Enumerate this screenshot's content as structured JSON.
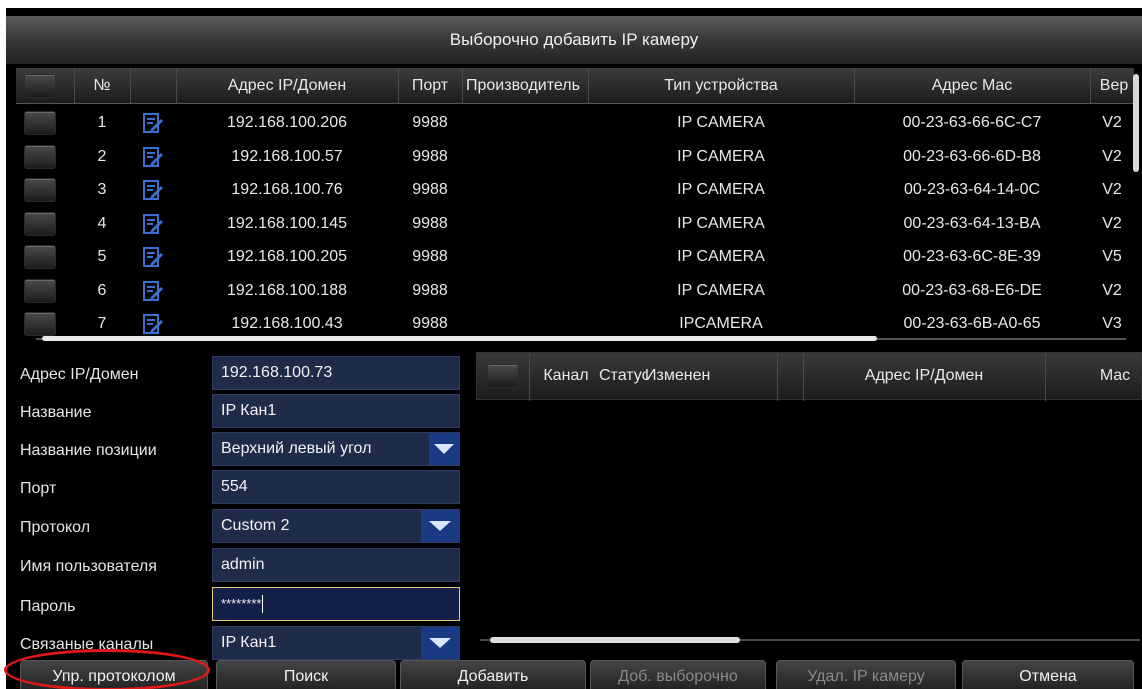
{
  "window": {
    "title": "Выборочно добавить IP камеру"
  },
  "camera_table": {
    "columns": [
      "№",
      "Адрес IP/Домен",
      "Порт",
      "Производитель",
      "Тип устройства",
      "Адрес Mac",
      "Вер"
    ],
    "rows": [
      {
        "num": "1",
        "ip": "192.168.100.206",
        "port": "9988",
        "vendor": "",
        "type": "IP CAMERA",
        "mac": "00-23-63-66-6C-C7",
        "ver": "V2"
      },
      {
        "num": "2",
        "ip": "192.168.100.57",
        "port": "9988",
        "vendor": "",
        "type": "IP CAMERA",
        "mac": "00-23-63-66-6D-B8",
        "ver": "V2"
      },
      {
        "num": "3",
        "ip": "192.168.100.76",
        "port": "9988",
        "vendor": "",
        "type": "IP CAMERA",
        "mac": "00-23-63-64-14-0C",
        "ver": "V2"
      },
      {
        "num": "4",
        "ip": "192.168.100.145",
        "port": "9988",
        "vendor": "",
        "type": "IP CAMERA",
        "mac": "00-23-63-64-13-BA",
        "ver": "V2"
      },
      {
        "num": "5",
        "ip": "192.168.100.205",
        "port": "9988",
        "vendor": "",
        "type": "IP CAMERA",
        "mac": "00-23-63-6C-8E-39",
        "ver": "V5"
      },
      {
        "num": "6",
        "ip": "192.168.100.188",
        "port": "9988",
        "vendor": "",
        "type": "IP CAMERA",
        "mac": "00-23-63-68-E6-DE",
        "ver": "V2"
      },
      {
        "num": "7",
        "ip": "192.168.100.43",
        "port": "9988",
        "vendor": "",
        "type": "IPCAMERA",
        "mac": "00-23-63-6B-A0-65",
        "ver": "V3"
      }
    ]
  },
  "form": {
    "ip_label": "Адрес IP/Домен",
    "ip_value": "192.168.100.73",
    "name_label": "Название",
    "name_value": "IP Кан1",
    "position_label": "Название позиции",
    "position_value": "Верхний левый угол",
    "port_label": "Порт",
    "port_value": "554",
    "protocol_label": "Протокол",
    "protocol_value": "Custom 2",
    "user_label": "Имя пользователя",
    "user_value": "admin",
    "password_label": "Пароль",
    "password_value": "********",
    "channels_label": "Связаные каналы",
    "channels_value": "IP Кан1"
  },
  "channel_list": {
    "columns": [
      "Канал",
      "Статус",
      "Изменен",
      "Адрес IP/Домен",
      "Mac"
    ]
  },
  "buttons": {
    "protocol": "Упр. протоколом",
    "search": "Поиск",
    "add": "Добавить",
    "add_selected": "Доб. выборочно",
    "delete": "Удал. IP камеру",
    "cancel": "Отмена"
  },
  "colors": {
    "field_bg": "#1e2b49",
    "dropdown_arrow_bg": "#1a3a86",
    "highlight_ring": "#e01818",
    "edit_icon": "#3b6fd0"
  }
}
